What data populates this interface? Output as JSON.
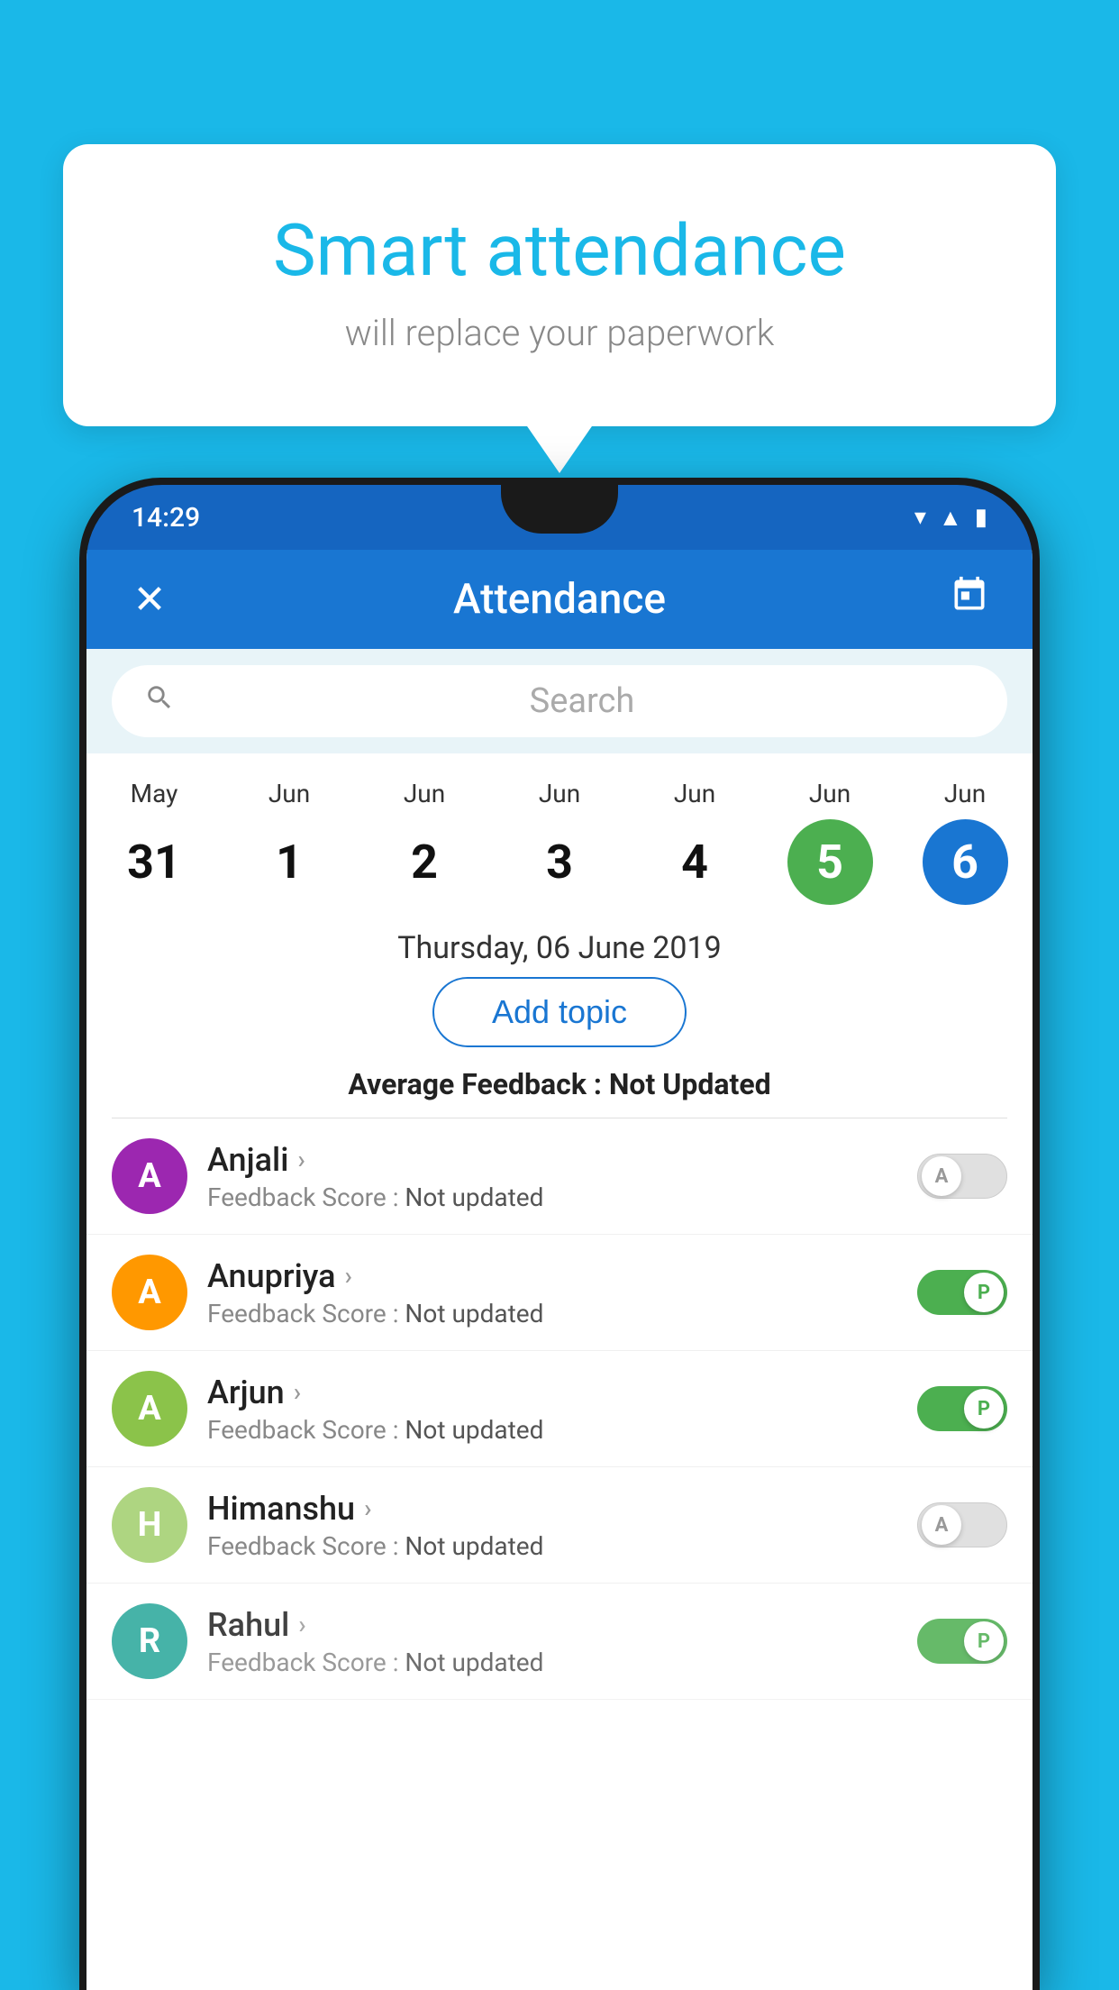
{
  "background_color": "#1ab8e8",
  "speech_bubble": {
    "title": "Smart attendance",
    "subtitle": "will replace your paperwork"
  },
  "status_bar": {
    "time": "14:29"
  },
  "app_bar": {
    "title": "Attendance",
    "close_icon": "✕",
    "calendar_icon": "📅"
  },
  "search": {
    "placeholder": "Search"
  },
  "calendar": {
    "days": [
      {
        "month": "May",
        "date": "31",
        "style": "normal"
      },
      {
        "month": "Jun",
        "date": "1",
        "style": "normal"
      },
      {
        "month": "Jun",
        "date": "2",
        "style": "normal"
      },
      {
        "month": "Jun",
        "date": "3",
        "style": "normal"
      },
      {
        "month": "Jun",
        "date": "4",
        "style": "normal"
      },
      {
        "month": "Jun",
        "date": "5",
        "style": "green"
      },
      {
        "month": "Jun",
        "date": "6",
        "style": "blue"
      }
    ],
    "selected_date": "Thursday, 06 June 2019"
  },
  "add_topic_label": "Add topic",
  "avg_feedback_label": "Average Feedback :",
  "avg_feedback_value": "Not Updated",
  "students": [
    {
      "name": "Anjali",
      "avatar_letter": "A",
      "avatar_color": "purple",
      "feedback": "Not updated",
      "status": "absent"
    },
    {
      "name": "Anupriya",
      "avatar_letter": "A",
      "avatar_color": "orange",
      "feedback": "Not updated",
      "status": "present"
    },
    {
      "name": "Arjun",
      "avatar_letter": "A",
      "avatar_color": "green",
      "feedback": "Not updated",
      "status": "present"
    },
    {
      "name": "Himanshu",
      "avatar_letter": "H",
      "avatar_color": "lightgreen",
      "feedback": "Not updated",
      "status": "absent"
    },
    {
      "name": "Rahul",
      "avatar_letter": "R",
      "avatar_color": "teal",
      "feedback": "Not updated",
      "status": "present"
    }
  ],
  "feedback_label": "Feedback Score :",
  "toggle_labels": {
    "absent": "A",
    "present": "P"
  }
}
